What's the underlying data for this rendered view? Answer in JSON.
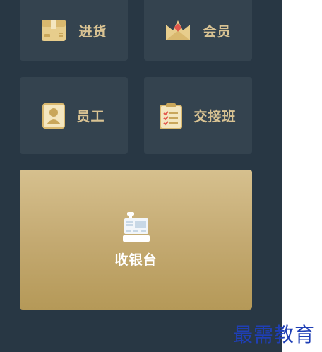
{
  "tiles": {
    "jinhuo": {
      "label": "进货",
      "icon": "box-icon"
    },
    "huiyuan": {
      "label": "会员",
      "icon": "crown-icon"
    },
    "yuangong": {
      "label": "员工",
      "icon": "id-card-icon"
    },
    "jiaojie": {
      "label": "交接班",
      "icon": "clipboard-icon"
    }
  },
  "cashier": {
    "label": "收银台",
    "icon": "cash-register-icon"
  },
  "watermark": {
    "text": "最需教育"
  },
  "colors": {
    "panel_bg": "#283744",
    "tile_bg": "#34434f",
    "tile_label": "#d9c393",
    "cashier_gradient_top": "#d6c08e",
    "cashier_gradient_bottom": "#b59958",
    "watermark": "#1f3fb5"
  }
}
